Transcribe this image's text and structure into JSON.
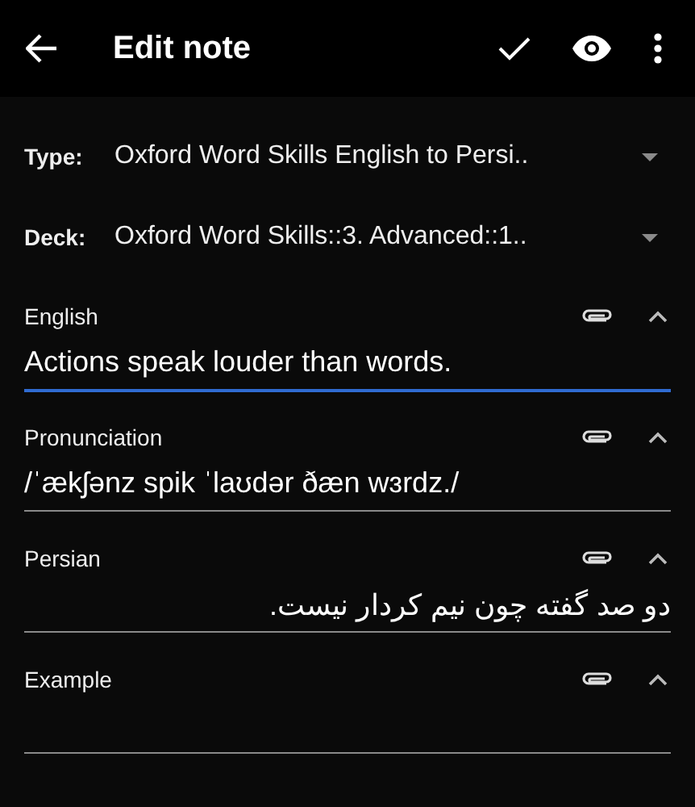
{
  "app_bar": {
    "title": "Edit note"
  },
  "selectors": [
    {
      "label": "Type:",
      "value": "Oxford Word Skills English to Persi.."
    },
    {
      "label": "Deck:",
      "value": "Oxford Word Skills::3. Advanced::1.."
    }
  ],
  "fields": [
    {
      "name": "English",
      "value": "Actions speak louder than words.",
      "focused": true
    },
    {
      "name": "Pronunciation",
      "value": "/ˈækʃənz spik ˈlaʊdər ðæn wɜrdz./",
      "focused": false
    },
    {
      "name": "Persian",
      "value": "دو صد گفته چون نیم کردار نیست.",
      "focused": false
    },
    {
      "name": "Example",
      "focused": false
    }
  ]
}
